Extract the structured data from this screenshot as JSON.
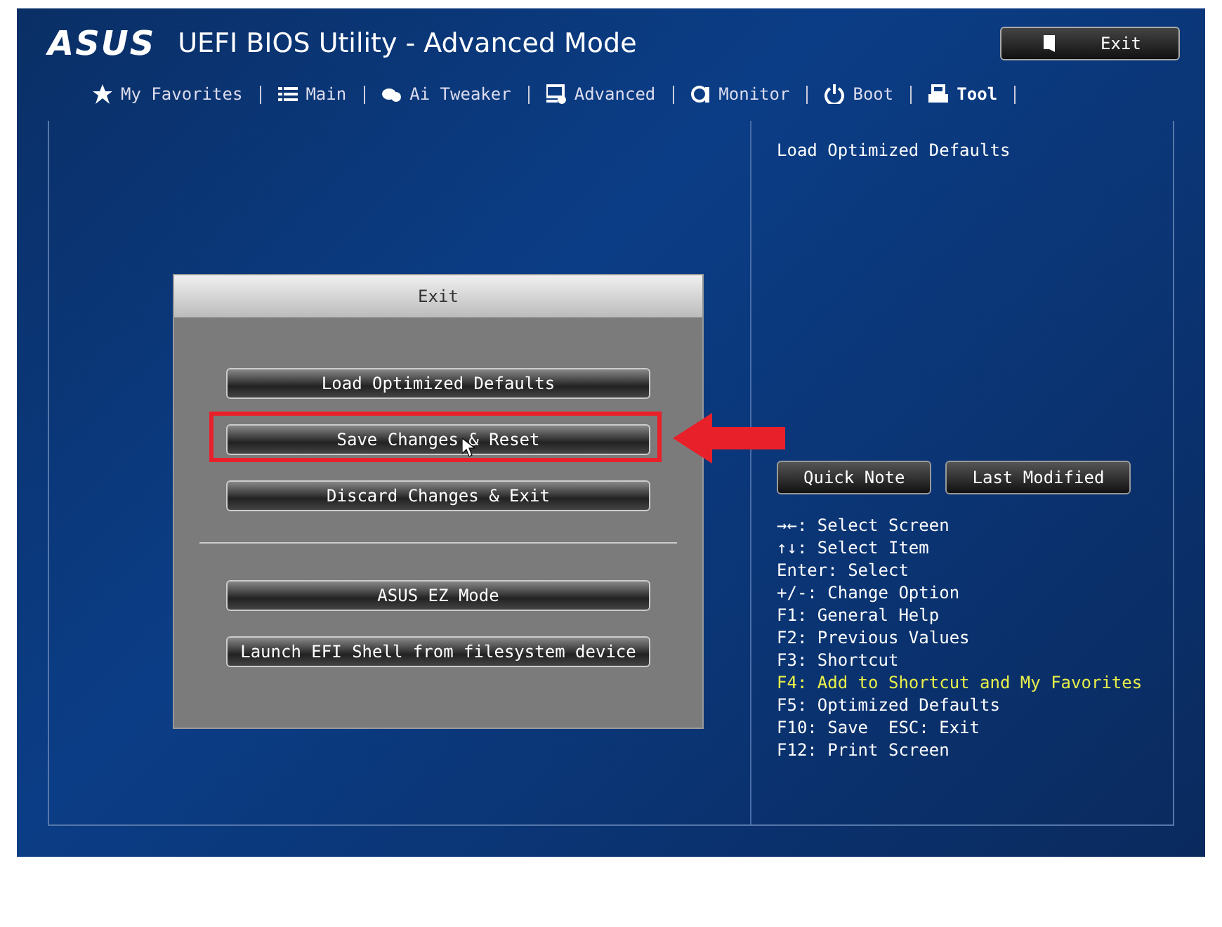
{
  "header": {
    "logo": "ASUS",
    "title": "UEFI BIOS Utility - Advanced Mode",
    "exit_button": "Exit"
  },
  "tabs": [
    {
      "label": "My Favorites",
      "selected": false
    },
    {
      "label": "Main",
      "selected": false
    },
    {
      "label": "Ai Tweaker",
      "selected": false
    },
    {
      "label": "Advanced",
      "selected": false
    },
    {
      "label": "Monitor",
      "selected": false
    },
    {
      "label": "Boot",
      "selected": false
    },
    {
      "label": "Tool",
      "selected": true
    }
  ],
  "dialog": {
    "title": "Exit",
    "groups": [
      [
        {
          "label": "Load Optimized Defaults",
          "highlighted": false
        },
        {
          "label": "Save Changes & Reset",
          "highlighted": true
        },
        {
          "label": "Discard Changes & Exit",
          "highlighted": false
        }
      ],
      [
        {
          "label": "ASUS EZ Mode",
          "highlighted": false
        },
        {
          "label": "Launch EFI Shell from filesystem device",
          "highlighted": false
        }
      ]
    ]
  },
  "help": {
    "description": "Load Optimized Defaults",
    "buttons": [
      "Quick Note",
      "Last Modified"
    ],
    "keys": [
      {
        "text": "→←: Select Screen",
        "highlighted": false
      },
      {
        "text": "↑↓: Select Item",
        "highlighted": false
      },
      {
        "text": "Enter: Select",
        "highlighted": false
      },
      {
        "text": "+/-: Change Option",
        "highlighted": false
      },
      {
        "text": "F1: General Help",
        "highlighted": false
      },
      {
        "text": "F2: Previous Values",
        "highlighted": false
      },
      {
        "text": "F3: Shortcut",
        "highlighted": false
      },
      {
        "text": "F4: Add to Shortcut and My Favorites",
        "highlighted": true
      },
      {
        "text": "F5: Optimized Defaults",
        "highlighted": false
      },
      {
        "text": "F10: Save  ESC: Exit",
        "highlighted": false
      },
      {
        "text": "F12: Print Screen",
        "highlighted": false
      }
    ]
  }
}
